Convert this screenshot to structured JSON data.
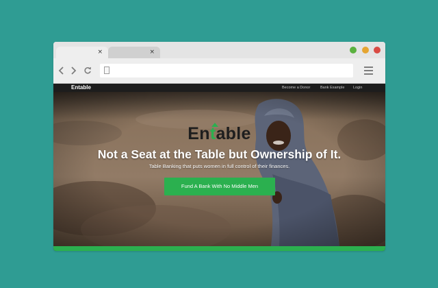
{
  "browser": {
    "tabs": [
      {
        "close_glyph": "×"
      },
      {
        "close_glyph": "×"
      }
    ],
    "window_controls": {
      "green": "#5bb13f",
      "yellow": "#e5a532",
      "red": "#d94b44"
    },
    "nav": {
      "back_icon": "‹",
      "forward_icon": "›",
      "reload_icon": "↻"
    },
    "address": {
      "value": "",
      "icon": "document-icon"
    },
    "menu_icon": "hamburger-menu-icon"
  },
  "site": {
    "nav": {
      "logo": "Entable",
      "links": [
        "Become a Donor",
        "Bank Example",
        "Login"
      ]
    },
    "hero": {
      "logo_start": "En",
      "logo_mark": "t",
      "logo_end": "able",
      "title": "Not a Seat at the Table but Ownership of It.",
      "subtitle": "Table Banking that puts women in full control of their finances.",
      "cta_label": "Fund A Bank With No Middle Men"
    },
    "accent_color": "#2bb04f"
  }
}
